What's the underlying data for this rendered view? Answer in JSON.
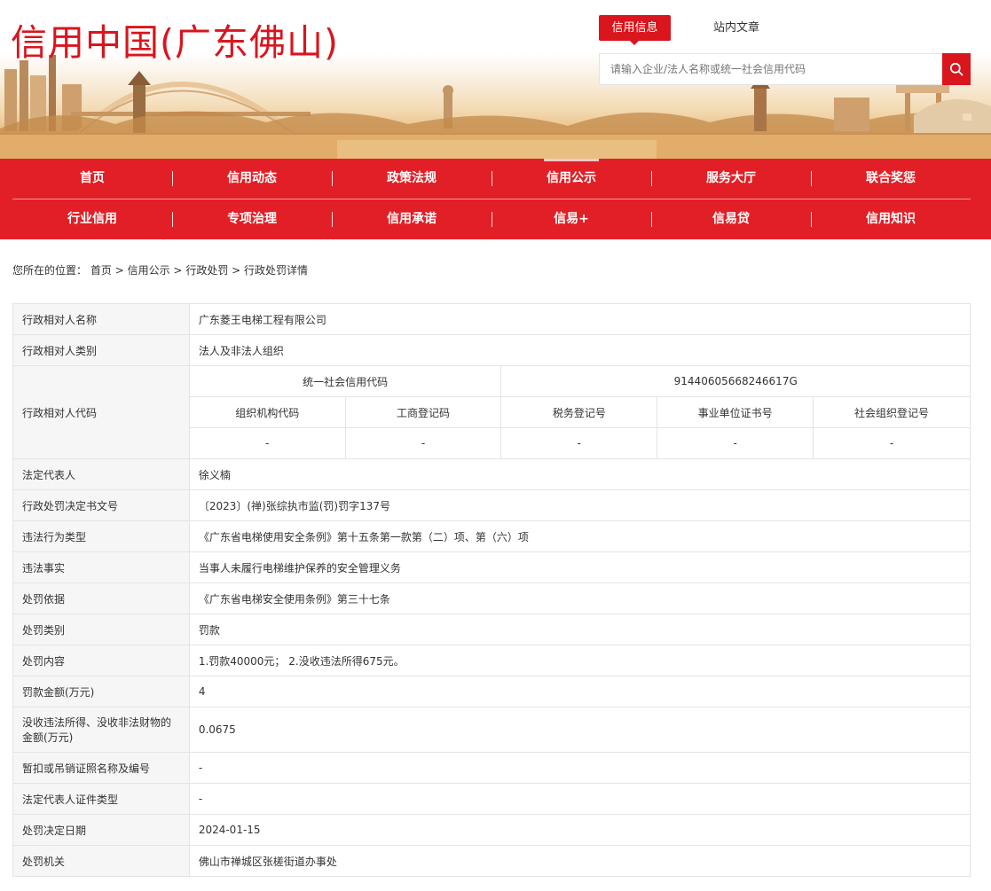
{
  "site": {
    "title": "信用中国(广东佛山)"
  },
  "search": {
    "tabs": [
      "信用信息",
      "站内文章"
    ],
    "placeholder": "请输入企业/法人名称或统一社会信用代码",
    "button_icon": "search-icon"
  },
  "nav": {
    "row1": [
      "首页",
      "信用动态",
      "政策法规",
      "信用公示",
      "服务大厅",
      "联合奖惩"
    ],
    "row2": [
      "行业信用",
      "专项治理",
      "信用承诺",
      "信易+",
      "信易贷",
      "信用知识"
    ],
    "current": "信用公示"
  },
  "breadcrumb": {
    "prefix": "您所在的位置：",
    "items": [
      "首页",
      "信用公示",
      "行政处罚",
      "行政处罚详情"
    ],
    "separator": ">"
  },
  "record": {
    "name": {
      "label": "行政相对人名称",
      "value": "广东菱王电梯工程有限公司"
    },
    "category": {
      "label": "行政相对人类别",
      "value": "法人及非法人组织"
    },
    "code": {
      "label": "行政相对人代码",
      "uscc_label": "统一社会信用代码",
      "uscc_value": "91440605668246617G",
      "sub_headers": [
        "组织机构代码",
        "工商登记码",
        "税务登记号",
        "事业单位证书号",
        "社会组织登记号"
      ],
      "sub_values": [
        "-",
        "-",
        "-",
        "-",
        "-"
      ]
    },
    "rows": [
      {
        "label": "法定代表人",
        "value": "徐义楠"
      },
      {
        "label": "行政处罚决定书文号",
        "value": "〔2023〕(禅)张综执市监(罚)罚字137号"
      },
      {
        "label": "违法行为类型",
        "value": "《广东省电梯使用安全条例》第十五条第一款第（二）项、第（六）项"
      },
      {
        "label": "违法事实",
        "value": "当事人未履行电梯维护保养的安全管理义务"
      },
      {
        "label": "处罚依据",
        "value": "《广东省电梯安全使用条例》第三十七条"
      },
      {
        "label": "处罚类别",
        "value": "罚款"
      },
      {
        "label": "处罚内容",
        "value": "1.罚款40000元； 2.没收违法所得675元。"
      },
      {
        "label": "罚款金额(万元)",
        "value": "4"
      },
      {
        "label": "没收违法所得、没收非法财物的金额(万元)",
        "value": "0.0675"
      },
      {
        "label": "暂扣或吊销证照名称及编号",
        "value": "-"
      },
      {
        "label": "法定代表人证件类型",
        "value": "-"
      },
      {
        "label": "处罚决定日期",
        "value": "2024-01-15"
      },
      {
        "label": "处罚机关",
        "value": "佛山市禅城区张槎街道办事处"
      }
    ]
  },
  "colors": {
    "brand_red": "#e21f26",
    "title_red": "#d9151d",
    "label_bg": "#f6f6f6",
    "border": "#e4e4e4"
  }
}
